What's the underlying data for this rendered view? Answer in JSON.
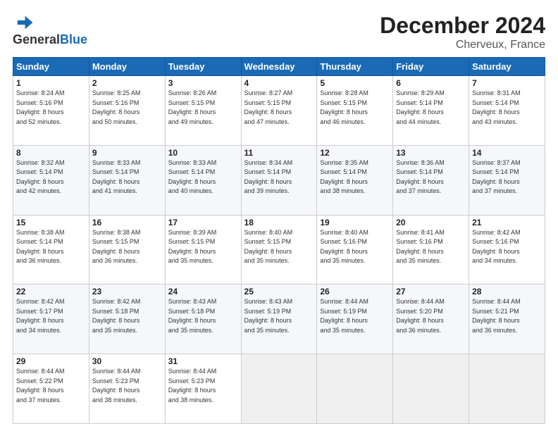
{
  "header": {
    "logo_general": "General",
    "logo_blue": "Blue",
    "title": "December 2024",
    "subtitle": "Cherveux, France"
  },
  "days_of_week": [
    "Sunday",
    "Monday",
    "Tuesday",
    "Wednesday",
    "Thursday",
    "Friday",
    "Saturday"
  ],
  "weeks": [
    [
      {
        "day": "1",
        "info": "Sunrise: 8:24 AM\nSunset: 5:16 PM\nDaylight: 8 hours\nand 52 minutes."
      },
      {
        "day": "2",
        "info": "Sunrise: 8:25 AM\nSunset: 5:16 PM\nDaylight: 8 hours\nand 50 minutes."
      },
      {
        "day": "3",
        "info": "Sunrise: 8:26 AM\nSunset: 5:15 PM\nDaylight: 8 hours\nand 49 minutes."
      },
      {
        "day": "4",
        "info": "Sunrise: 8:27 AM\nSunset: 5:15 PM\nDaylight: 8 hours\nand 47 minutes."
      },
      {
        "day": "5",
        "info": "Sunrise: 8:28 AM\nSunset: 5:15 PM\nDaylight: 8 hours\nand 46 minutes."
      },
      {
        "day": "6",
        "info": "Sunrise: 8:29 AM\nSunset: 5:14 PM\nDaylight: 8 hours\nand 44 minutes."
      },
      {
        "day": "7",
        "info": "Sunrise: 8:31 AM\nSunset: 5:14 PM\nDaylight: 8 hours\nand 43 minutes."
      }
    ],
    [
      {
        "day": "8",
        "info": "Sunrise: 8:32 AM\nSunset: 5:14 PM\nDaylight: 8 hours\nand 42 minutes."
      },
      {
        "day": "9",
        "info": "Sunrise: 8:33 AM\nSunset: 5:14 PM\nDaylight: 8 hours\nand 41 minutes."
      },
      {
        "day": "10",
        "info": "Sunrise: 8:33 AM\nSunset: 5:14 PM\nDaylight: 8 hours\nand 40 minutes."
      },
      {
        "day": "11",
        "info": "Sunrise: 8:34 AM\nSunset: 5:14 PM\nDaylight: 8 hours\nand 39 minutes."
      },
      {
        "day": "12",
        "info": "Sunrise: 8:35 AM\nSunset: 5:14 PM\nDaylight: 8 hours\nand 38 minutes."
      },
      {
        "day": "13",
        "info": "Sunrise: 8:36 AM\nSunset: 5:14 PM\nDaylight: 8 hours\nand 37 minutes."
      },
      {
        "day": "14",
        "info": "Sunrise: 8:37 AM\nSunset: 5:14 PM\nDaylight: 8 hours\nand 37 minutes."
      }
    ],
    [
      {
        "day": "15",
        "info": "Sunrise: 8:38 AM\nSunset: 5:14 PM\nDaylight: 8 hours\nand 36 minutes."
      },
      {
        "day": "16",
        "info": "Sunrise: 8:38 AM\nSunset: 5:15 PM\nDaylight: 8 hours\nand 36 minutes."
      },
      {
        "day": "17",
        "info": "Sunrise: 8:39 AM\nSunset: 5:15 PM\nDaylight: 8 hours\nand 35 minutes."
      },
      {
        "day": "18",
        "info": "Sunrise: 8:40 AM\nSunset: 5:15 PM\nDaylight: 8 hours\nand 35 minutes."
      },
      {
        "day": "19",
        "info": "Sunrise: 8:40 AM\nSunset: 5:16 PM\nDaylight: 8 hours\nand 35 minutes."
      },
      {
        "day": "20",
        "info": "Sunrise: 8:41 AM\nSunset: 5:16 PM\nDaylight: 8 hours\nand 35 minutes."
      },
      {
        "day": "21",
        "info": "Sunrise: 8:42 AM\nSunset: 5:16 PM\nDaylight: 8 hours\nand 34 minutes."
      }
    ],
    [
      {
        "day": "22",
        "info": "Sunrise: 8:42 AM\nSunset: 5:17 PM\nDaylight: 8 hours\nand 34 minutes."
      },
      {
        "day": "23",
        "info": "Sunrise: 8:42 AM\nSunset: 5:18 PM\nDaylight: 8 hours\nand 35 minutes."
      },
      {
        "day": "24",
        "info": "Sunrise: 8:43 AM\nSunset: 5:18 PM\nDaylight: 8 hours\nand 35 minutes."
      },
      {
        "day": "25",
        "info": "Sunrise: 8:43 AM\nSunset: 5:19 PM\nDaylight: 8 hours\nand 35 minutes."
      },
      {
        "day": "26",
        "info": "Sunrise: 8:44 AM\nSunset: 5:19 PM\nDaylight: 8 hours\nand 35 minutes."
      },
      {
        "day": "27",
        "info": "Sunrise: 8:44 AM\nSunset: 5:20 PM\nDaylight: 8 hours\nand 36 minutes."
      },
      {
        "day": "28",
        "info": "Sunrise: 8:44 AM\nSunset: 5:21 PM\nDaylight: 8 hours\nand 36 minutes."
      }
    ],
    [
      {
        "day": "29",
        "info": "Sunrise: 8:44 AM\nSunset: 5:22 PM\nDaylight: 8 hours\nand 37 minutes."
      },
      {
        "day": "30",
        "info": "Sunrise: 8:44 AM\nSunset: 5:23 PM\nDaylight: 8 hours\nand 38 minutes."
      },
      {
        "day": "31",
        "info": "Sunrise: 8:44 AM\nSunset: 5:23 PM\nDaylight: 8 hours\nand 38 minutes."
      },
      {
        "day": "",
        "info": ""
      },
      {
        "day": "",
        "info": ""
      },
      {
        "day": "",
        "info": ""
      },
      {
        "day": "",
        "info": ""
      }
    ]
  ]
}
